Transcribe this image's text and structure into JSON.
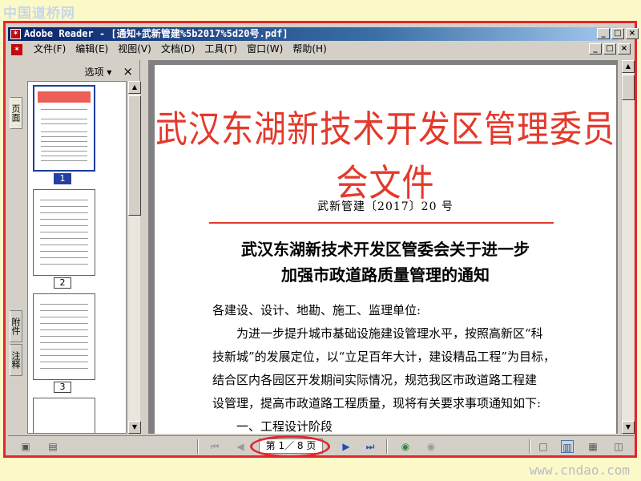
{
  "watermarks": {
    "top": "中国道桥网",
    "bottom": "www.cndao.com"
  },
  "window": {
    "app_name": "Adobe Reader",
    "title": "Adobe Reader - [通知+武新管建%5b2017%5d20号.pdf]",
    "controls": {
      "minimize": "_",
      "maximize": "□",
      "close": "×"
    }
  },
  "menu": {
    "items": [
      "文件(F)",
      "编辑(E)",
      "视图(V)",
      "文档(D)",
      "工具(T)",
      "窗口(W)",
      "帮助(H)"
    ]
  },
  "nav_panel": {
    "tabs": [
      "页面",
      "附件",
      "注释"
    ],
    "options_label": "选项 ▾",
    "close_label": "×",
    "thumbnails": [
      {
        "label": "1",
        "selected": true
      },
      {
        "label": "2",
        "selected": false
      },
      {
        "label": "3",
        "selected": false
      }
    ]
  },
  "document": {
    "red_header": "武汉东湖新技术开发区管理委员会文件",
    "doc_number": "武新管建〔2017〕20 号",
    "notice_title_line1": "武汉东湖新技术开发区管委会关于进一步",
    "notice_title_line2": "加强市政道路质量管理的通知",
    "addressee": "各建设、设计、地勘、施工、监理单位:",
    "paragraph_1_line1": "为进一步提升城市基础设施建设管理水平，按照高新区“科",
    "paragraph_1_line2": "技新城”的发展定位，以“立足百年大计，建设精品工程”为目标，",
    "paragraph_1_line3": "结合区内各园区开发期间实际情况，规范我区市政道路工程建",
    "paragraph_1_line4": "设管理，提高市政道路工程质量，现将有关要求事项通知如下:",
    "section_1": "一、工程设计阶段",
    "header_color": "#e33a2c"
  },
  "status_bar": {
    "page_indicator": "第 1／ 8 页",
    "current_page": 1,
    "total_pages": 8
  }
}
